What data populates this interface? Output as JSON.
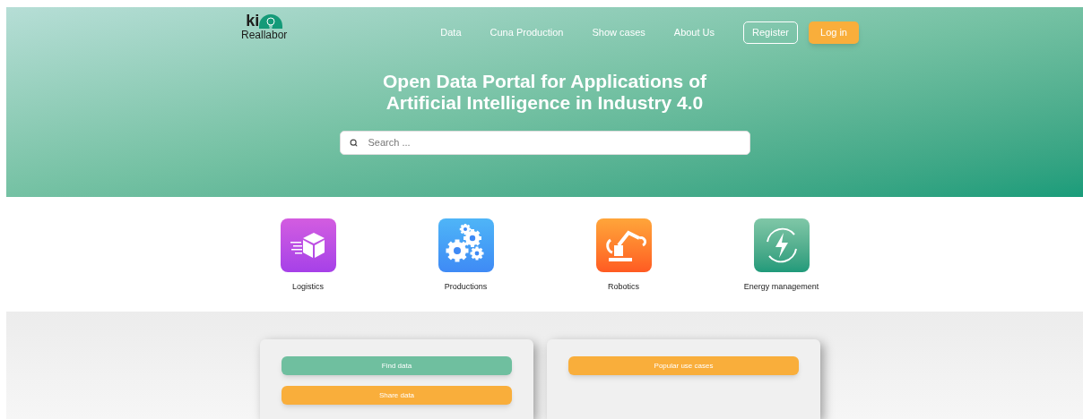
{
  "logo": {
    "mark": "ki",
    "name": "Reallabor"
  },
  "nav": [
    {
      "label": "Data",
      "kind": "link"
    },
    {
      "label": "Cuna Production",
      "kind": "link"
    },
    {
      "label": "Show cases",
      "kind": "link"
    },
    {
      "label": "About Us",
      "kind": "link"
    },
    {
      "label": "Register",
      "kind": "outline"
    },
    {
      "label": "Log in",
      "kind": "primary"
    }
  ],
  "hero": {
    "title": "Open Data Portal for Applications of Artificial Intelligence in Industry 4.0",
    "search": {
      "placeholder": "Search ..."
    }
  },
  "categories": [
    {
      "label": "Logistics",
      "kind": "logistics"
    },
    {
      "label": "Productions",
      "kind": "production"
    },
    {
      "label": "Robotics",
      "kind": "robotics"
    },
    {
      "label": "Energy management",
      "kind": "energy"
    }
  ],
  "cards": [
    {
      "buttons": [
        {
          "label": "Find data",
          "kind": "green"
        },
        {
          "label": "Share data",
          "kind": "orange"
        }
      ]
    },
    {
      "buttons": [
        {
          "label": "Popular use cases",
          "kind": "orange"
        }
      ]
    }
  ]
}
